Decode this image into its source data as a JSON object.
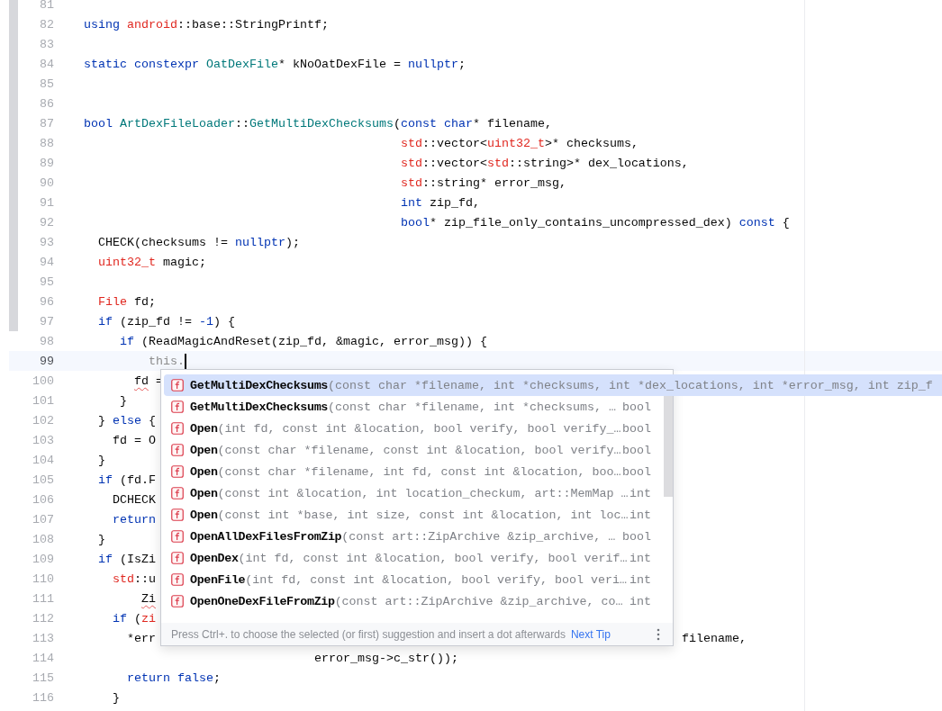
{
  "editor": {
    "lines": [
      {
        "number": "81",
        "changed": true,
        "current": false,
        "cursor": false
      },
      {
        "number": "82",
        "changed": true,
        "current": false,
        "cursor": false,
        "tokens": [
          {
            "text": "using ",
            "kind": "keyword"
          },
          {
            "text": "android",
            "kind": "type"
          },
          {
            "text": "::base::StringPrintf;",
            "kind": "plain"
          }
        ]
      },
      {
        "number": "83",
        "changed": true,
        "current": false,
        "cursor": false
      },
      {
        "number": "84",
        "changed": true,
        "current": false,
        "cursor": false,
        "tokens": [
          {
            "text": "static constexpr ",
            "kind": "keyword"
          },
          {
            "text": "OatDexFile",
            "kind": "class"
          },
          {
            "text": "* kNoOatDexFile = ",
            "kind": "plain"
          },
          {
            "text": "nullptr",
            "kind": "keyword"
          },
          {
            "text": ";",
            "kind": "plain"
          }
        ]
      },
      {
        "number": "85",
        "changed": true,
        "current": false,
        "cursor": false
      },
      {
        "number": "86",
        "changed": true,
        "current": false,
        "cursor": false
      },
      {
        "number": "87",
        "changed": true,
        "current": false,
        "cursor": false,
        "tokens": [
          {
            "text": "bool ",
            "kind": "keyword"
          },
          {
            "text": "ArtDexFileLoader",
            "kind": "class"
          },
          {
            "text": "::",
            "kind": "plain"
          },
          {
            "text": "GetMultiDexChecksums",
            "kind": "class"
          },
          {
            "text": "(",
            "kind": "plain"
          },
          {
            "text": "const char",
            "kind": "keyword"
          },
          {
            "text": "* filename,",
            "kind": "plain"
          }
        ]
      },
      {
        "number": "88",
        "changed": true,
        "current": false,
        "cursor": false,
        "tokens": [
          {
            "text": "                                            std",
            "kind": "type"
          },
          {
            "text": "::vector<",
            "kind": "plain"
          },
          {
            "text": "uint32_t",
            "kind": "type"
          },
          {
            "text": ">* checksums,",
            "kind": "plain"
          }
        ]
      },
      {
        "number": "89",
        "changed": true,
        "current": false,
        "cursor": false,
        "tokens": [
          {
            "text": "                                            std",
            "kind": "type"
          },
          {
            "text": "::vector<",
            "kind": "plain"
          },
          {
            "text": "std",
            "kind": "type"
          },
          {
            "text": "::string>* dex_locations,",
            "kind": "plain"
          }
        ]
      },
      {
        "number": "90",
        "changed": true,
        "current": false,
        "cursor": false,
        "tokens": [
          {
            "text": "                                            std",
            "kind": "type"
          },
          {
            "text": "::string* error_msg,",
            "kind": "plain"
          }
        ]
      },
      {
        "number": "91",
        "changed": true,
        "current": false,
        "cursor": false,
        "tokens": [
          {
            "text": "                                            int",
            "kind": "keyword"
          },
          {
            "text": " zip_fd,",
            "kind": "plain"
          }
        ]
      },
      {
        "number": "92",
        "changed": true,
        "current": false,
        "cursor": false,
        "tokens": [
          {
            "text": "                                            bool",
            "kind": "keyword"
          },
          {
            "text": "* zip_file_only_contains_uncompressed_dex) ",
            "kind": "plain"
          },
          {
            "text": "const",
            "kind": "keyword"
          },
          {
            "text": " {",
            "kind": "plain"
          }
        ]
      },
      {
        "number": "93",
        "changed": true,
        "current": false,
        "cursor": false,
        "tokens": [
          {
            "text": "  CHECK(checksums != ",
            "kind": "plain"
          },
          {
            "text": "nullptr",
            "kind": "keyword"
          },
          {
            "text": ");",
            "kind": "plain"
          }
        ]
      },
      {
        "number": "94",
        "changed": true,
        "current": false,
        "cursor": false,
        "tokens": [
          {
            "text": "  uint32_t",
            "kind": "type"
          },
          {
            "text": " magic;",
            "kind": "plain"
          }
        ]
      },
      {
        "number": "95",
        "changed": true,
        "current": false,
        "cursor": false
      },
      {
        "number": "96",
        "changed": true,
        "current": false,
        "cursor": false,
        "tokens": [
          {
            "text": "  File",
            "kind": "type"
          },
          {
            "text": " fd;",
            "kind": "plain"
          }
        ]
      },
      {
        "number": "97",
        "changed": true,
        "current": false,
        "cursor": false,
        "tokens": [
          {
            "text": "  if",
            "kind": "keyword"
          },
          {
            "text": " (zip_fd != ",
            "kind": "plain"
          },
          {
            "text": "-1",
            "kind": "keyword"
          },
          {
            "text": ") {",
            "kind": "plain"
          }
        ]
      },
      {
        "number": "98",
        "changed": false,
        "current": false,
        "cursor": false,
        "tokens": [
          {
            "text": "     if",
            "kind": "keyword"
          },
          {
            "text": " (ReadMagicAndReset(zip_fd, &magic, error_msg)) {",
            "kind": "plain"
          }
        ]
      },
      {
        "number": "99",
        "changed": false,
        "current": true,
        "cursor": true,
        "tokens": [
          {
            "text": "         this.",
            "kind": "muted"
          }
        ]
      },
      {
        "number": "100",
        "changed": false,
        "current": false,
        "cursor": false,
        "tokens": [
          {
            "text": "       fd",
            "kind": "plain",
            "squiggle": true
          },
          {
            "text": " =",
            "kind": "plain"
          }
        ]
      },
      {
        "number": "101",
        "changed": false,
        "current": false,
        "cursor": false,
        "tokens": [
          {
            "text": "     }",
            "kind": "plain"
          }
        ]
      },
      {
        "number": "102",
        "changed": false,
        "current": false,
        "cursor": false,
        "tokens": [
          {
            "text": "  } ",
            "kind": "plain"
          },
          {
            "text": "else",
            "kind": "keyword"
          },
          {
            "text": " {",
            "kind": "plain"
          }
        ]
      },
      {
        "number": "103",
        "changed": false,
        "current": false,
        "cursor": false,
        "tokens": [
          {
            "text": "    fd = O",
            "kind": "plain"
          }
        ]
      },
      {
        "number": "104",
        "changed": false,
        "current": false,
        "cursor": false,
        "tokens": [
          {
            "text": "  }",
            "kind": "plain"
          }
        ]
      },
      {
        "number": "105",
        "changed": false,
        "current": false,
        "cursor": false,
        "tokens": [
          {
            "text": "  if",
            "kind": "keyword"
          },
          {
            "text": " (fd.F",
            "kind": "plain"
          }
        ]
      },
      {
        "number": "106",
        "changed": false,
        "current": false,
        "cursor": false,
        "tokens": [
          {
            "text": "    DCHECK",
            "kind": "plain"
          }
        ]
      },
      {
        "number": "107",
        "changed": false,
        "current": false,
        "cursor": false,
        "tokens": [
          {
            "text": "    return",
            "kind": "keyword"
          }
        ]
      },
      {
        "number": "108",
        "changed": false,
        "current": false,
        "cursor": false,
        "tokens": [
          {
            "text": "  }",
            "kind": "plain"
          }
        ]
      },
      {
        "number": "109",
        "changed": false,
        "current": false,
        "cursor": false,
        "tokens": [
          {
            "text": "  if",
            "kind": "keyword"
          },
          {
            "text": " (IsZi",
            "kind": "plain"
          }
        ]
      },
      {
        "number": "110",
        "changed": false,
        "current": false,
        "cursor": false,
        "tokens": [
          {
            "text": "    std",
            "kind": "type"
          },
          {
            "text": "::u",
            "kind": "plain"
          }
        ]
      },
      {
        "number": "111",
        "changed": false,
        "current": false,
        "cursor": false,
        "tokens": [
          {
            "text": "        Zi",
            "kind": "plain",
            "squiggle": true
          }
        ]
      },
      {
        "number": "112",
        "changed": false,
        "current": false,
        "cursor": false,
        "tokens": [
          {
            "text": "    if",
            "kind": "keyword"
          },
          {
            "text": " (",
            "kind": "plain"
          },
          {
            "text": "zi",
            "kind": "type"
          }
        ]
      },
      {
        "number": "113",
        "changed": false,
        "current": false,
        "cursor": false,
        "tokens": [
          {
            "text": "      *err",
            "kind": "plain"
          }
        ],
        "tail": "filename,"
      },
      {
        "number": "114",
        "changed": false,
        "current": false,
        "cursor": false,
        "tokens": [
          {
            "text": "                                error_msg->c_str());",
            "kind": "plain"
          }
        ]
      },
      {
        "number": "115",
        "changed": false,
        "current": false,
        "cursor": false,
        "tokens": [
          {
            "text": "      return false",
            "kind": "keyword"
          },
          {
            "text": ";",
            "kind": "plain"
          }
        ]
      },
      {
        "number": "116",
        "changed": false,
        "current": false,
        "cursor": false,
        "tokens": [
          {
            "text": "    }",
            "kind": "plain"
          }
        ]
      }
    ]
  },
  "completion": {
    "items": [
      {
        "name": "GetMultiDexChecksums",
        "params": "(const char *filename, int *checksums, int *dex_locations, int *error_msg, int zip_f",
        "selected": true
      },
      {
        "name": "GetMultiDexChecksums",
        "params": "(const char *filename, int *checksums, …",
        "type": "bool",
        "selected": false
      },
      {
        "name": "Open",
        "params": "(int fd, const int &location, bool verify, bool verify_…",
        "type": "bool",
        "selected": false
      },
      {
        "name": "Open",
        "params": "(const char *filename, const int &location, bool verify…",
        "type": "bool",
        "selected": false
      },
      {
        "name": "Open",
        "params": "(const char *filename, int fd, const int &location, boo…",
        "type": "bool",
        "selected": false
      },
      {
        "name": "Open",
        "params": "(const int &location, int location_checkum, art::MemMap …",
        "type": "int",
        "selected": false
      },
      {
        "name": "Open",
        "params": "(const int *base, int size, const int &location, int loc…",
        "type": "int",
        "selected": false
      },
      {
        "name": "OpenAllDexFilesFromZip",
        "params": "(const art::ZipArchive &zip_archive, …",
        "type": "bool",
        "selected": false
      },
      {
        "name": "OpenDex",
        "params": "(int fd, const int &location, bool verify, bool verif…",
        "type": "int",
        "selected": false
      },
      {
        "name": "OpenFile",
        "params": "(int fd, const int &location, bool verify, bool veri…",
        "type": "int",
        "selected": false
      },
      {
        "name": "OpenOneDexFileFromZip",
        "params": "(const art::ZipArchive &zip_archive, co…",
        "type": "int",
        "selected": false
      }
    ],
    "footer": {
      "hint": "Press Ctrl+. to choose the selected (or first) suggestion and insert a dot afterwards",
      "link": "Next Tip"
    }
  }
}
